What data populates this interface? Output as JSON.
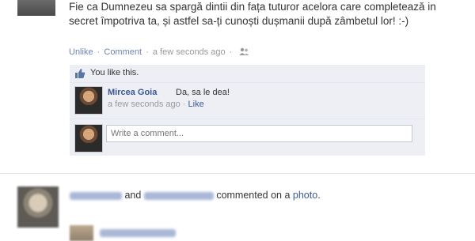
{
  "post": {
    "text": "Fie ca Dumnezeu sa spargă dintii din fața tuturor acelora care completează in secret împotriva ta, și astfel sa-ți cunoști dușmanii după zâmbetul lor! :-)",
    "unlike_label": "Unlike",
    "comment_label": "Comment",
    "separator": "·",
    "timestamp": "a few seconds ago",
    "audience_icon": "people-icon"
  },
  "likes": {
    "text": "You like this.",
    "icon": "thumbs-up-icon"
  },
  "comment": {
    "author": "Mircea Goia",
    "body": "Da, sa le dea!",
    "timestamp": "a few seconds ago",
    "separator": "·",
    "like_label": "Like"
  },
  "composer": {
    "placeholder": "Write a comment..."
  },
  "feed_story": {
    "connector": "and",
    "action": "commented on a",
    "object_link": "photo",
    "end": "."
  },
  "colors": {
    "link": "#3b5998",
    "panel": "#edeff4",
    "muted": "#999999"
  }
}
